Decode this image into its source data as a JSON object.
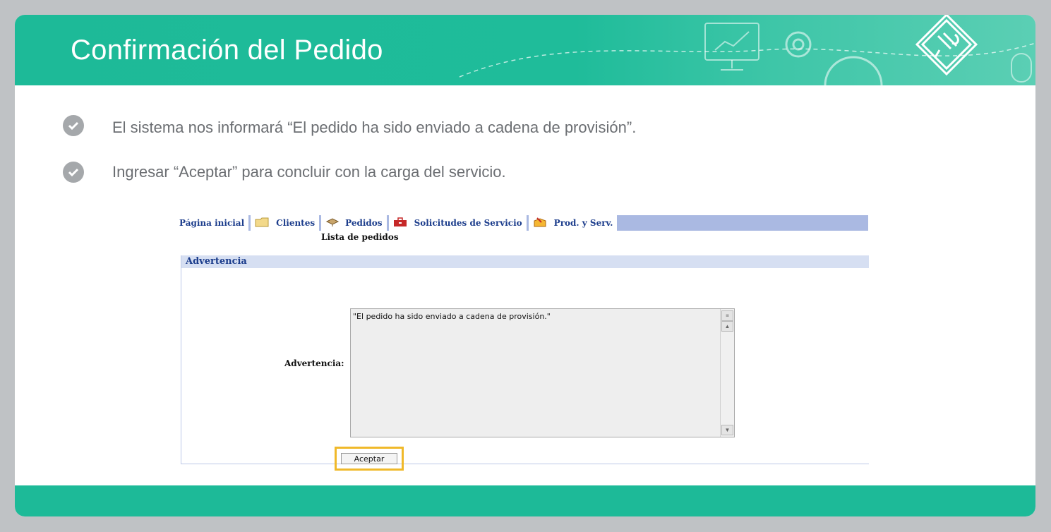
{
  "slide": {
    "title": "Confirmación del Pedido",
    "bullets": [
      "El sistema nos informará “El pedido ha sido enviado a cadena de provisión”.",
      "Ingresar “Aceptar” para concluir con la carga del servicio."
    ]
  },
  "app": {
    "tabs": [
      {
        "label": "Página inicial",
        "icon": "none"
      },
      {
        "label": "Clientes",
        "icon": "folder-icon"
      },
      {
        "label": "Pedidos",
        "icon": "package-icon"
      },
      {
        "label": "Solicitudes de Servicio",
        "icon": "toolbox-icon"
      },
      {
        "label": "Prod. y Serv.",
        "icon": "box-icon"
      }
    ],
    "sub_label": "Lista de pedidos",
    "panel_title": "Advertencia",
    "field_label": "Advertencia:",
    "message": "\"El pedido ha sido enviado a cadena de provisión.\"",
    "accept_label": "Aceptar"
  },
  "colors": {
    "header": "#1dba98",
    "highlight": "#f0b92a",
    "tab_text": "#1c3d8c"
  }
}
